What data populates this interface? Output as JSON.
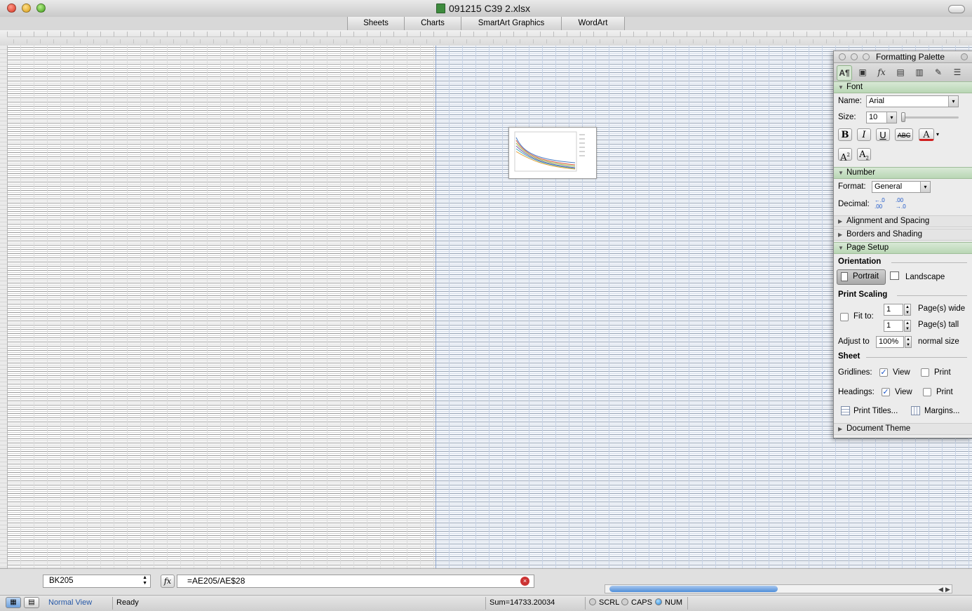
{
  "window": {
    "title": "091215 C39 2.xlsx"
  },
  "ribbon": {
    "tabs": [
      "Sheets",
      "Charts",
      "SmartArt Graphics",
      "WordArt"
    ]
  },
  "palette": {
    "title": "Formatting Palette",
    "font_section": "Font",
    "name_label": "Name:",
    "font_name": "Arial",
    "size_label": "Size:",
    "font_size": "10",
    "bold": "B",
    "italic": "I",
    "underline": "U",
    "strike": "ABC",
    "font_color": "A",
    "superscript": "A",
    "subscript": "A",
    "number_section": "Number",
    "format_label": "Format:",
    "format_value": "General",
    "decimal_label": "Decimal:",
    "alignment_section": "Alignment and Spacing",
    "borders_section": "Borders and Shading",
    "page_setup_section": "Page Setup",
    "orientation_heading": "Orientation",
    "portrait": "Portrait",
    "landscape": "Landscape",
    "print_scaling_heading": "Print Scaling",
    "fit_to": "Fit to:",
    "pages_wide_value": "1",
    "pages_wide_label": "Page(s) wide",
    "pages_tall_value": "1",
    "pages_tall_label": "Page(s) tall",
    "adjust_to": "Adjust to",
    "adjust_value": "100%",
    "normal_size": "normal size",
    "sheet_heading": "Sheet",
    "gridlines_label": "Gridlines:",
    "gridlines_view": "View",
    "gridlines_view_checked": true,
    "gridlines_print": "Print",
    "headings_label": "Headings:",
    "headings_view": "View",
    "headings_view_checked": true,
    "headings_print": "Print",
    "print_titles": "Print Titles...",
    "margins": "Margins...",
    "document_theme_section": "Document Theme"
  },
  "formula_bar": {
    "name_box": "BK205",
    "fx": "fx",
    "formula": "=AE205/AE$28"
  },
  "status_bar": {
    "view_name": "Normal View",
    "ready": "Ready",
    "sum": "Sum=14733.20034",
    "scrl": "SCRL",
    "caps": "CAPS",
    "num": "NUM",
    "num_on": true
  },
  "colors": {
    "palette_section_green": "#b9d6b4",
    "selection_blue": "#4e8dd8",
    "selected_range_tint": "#f3f6fb"
  },
  "icons": [
    "paragraph-icon",
    "image-add-icon",
    "function-icon",
    "toolbox-icon",
    "library-icon",
    "wrench-icon",
    "tray-icon"
  ]
}
